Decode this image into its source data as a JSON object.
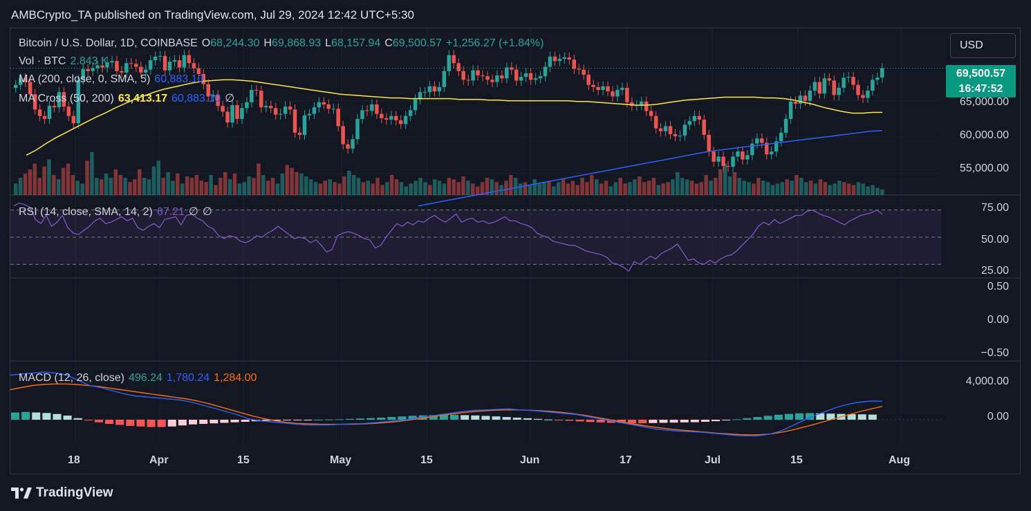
{
  "header": {
    "published": "AMBCrypto_TA published on TradingView.com, Jul 29, 2024 12:42 UTC+5:30"
  },
  "legend": {
    "symbol": "Bitcoin / U.S. Dollar, 1D, COINBASE",
    "open_label": "O",
    "open": "68,244.30",
    "high_label": "H",
    "high": "69,868.93",
    "low_label": "L",
    "low": "68,157.94",
    "close_label": "C",
    "close": "69,500.57",
    "change": "+1,256.27 (+1.84%)",
    "vol_label": "Vol · BTC",
    "vol": "2.843 K",
    "ma_label": "MA (200, close, 0, SMA, 5)",
    "ma_value": "60,883.10",
    "macross_label": "MA Cross (50, 200)",
    "macross_fast": "63,413.17",
    "macross_slow": "60,883.10",
    "macross_extra": "∅",
    "rsi_label": "RSI (14, close, SMA, 14, 2)",
    "rsi_value": "67.21",
    "rsi_extra1": "∅",
    "rsi_extra2": "∅",
    "macd_label": "MACD (12, 26, close)",
    "macd_hist": "496.24",
    "macd_line": "1,780.24",
    "macd_signal": "1,284.00"
  },
  "currency_button": "USD",
  "price_tag": {
    "price": "69,500.57",
    "countdown": "16:47:52"
  },
  "footer": {
    "brand": "TradingView"
  },
  "colors": {
    "up": "#26a69a",
    "down": "#ef5350",
    "ma200": "#2962ff",
    "ma50": "#ffeb3b",
    "rsi": "#7e57c2",
    "macd_fast": "#2962ff",
    "macd_slow": "#ff6d00"
  },
  "chart_data": {
    "type": "candlestick",
    "price_axis": {
      "ticks": [
        "65,000.00",
        "60,000.00",
        "55,000.00"
      ],
      "tick_values": [
        65000,
        60000,
        55000
      ],
      "ylim": [
        52000,
        75000
      ]
    },
    "x_axis": {
      "ticks": [
        "18",
        "Apr",
        "15",
        "May",
        "15",
        "Jun",
        "17",
        "Jul",
        "15",
        "Aug"
      ]
    },
    "rsi_axis": {
      "ticks": [
        "75.00",
        "50.00",
        "25.00"
      ],
      "ylim": [
        20,
        80
      ],
      "bands": [
        70,
        50,
        30
      ]
    },
    "empty_pane_axis": {
      "ticks": [
        "0.50",
        "0.00",
        "−0.50"
      ]
    },
    "macd_axis": {
      "ticks": [
        "4,000.00",
        "0.00"
      ],
      "ylim": [
        -2200,
        5600
      ]
    },
    "close": [
      67200,
      68100,
      67600,
      65900,
      63800,
      62900,
      62500,
      64300,
      64100,
      66200,
      64200,
      62900,
      61900,
      67900,
      69400,
      69100,
      69500,
      69900,
      69600,
      70300,
      70500,
      69100,
      68900,
      70200,
      70100,
      69700,
      68900,
      69300,
      70600,
      71100,
      71200,
      69200,
      70400,
      70600,
      69600,
      71300,
      70200,
      69500,
      68700,
      67300,
      65600,
      65800,
      64300,
      63500,
      62000,
      64400,
      62500,
      64000,
      64800,
      66500,
      66400,
      64100,
      64300,
      64000,
      63100,
      63200,
      64200,
      63800,
      60600,
      60300,
      63000,
      63200,
      64100,
      64800,
      64500,
      63900,
      63900,
      61500,
      59000,
      58400,
      59700,
      62500,
      63700,
      63600,
      64500,
      63200,
      62600,
      62400,
      62900,
      62300,
      61800,
      62900,
      63700,
      65200,
      66200,
      66200,
      67000,
      66300,
      66900,
      69100,
      71300,
      70200,
      69100,
      67900,
      67800,
      69200,
      68500,
      68400,
      67900,
      67600,
      68500,
      68100,
      69600,
      69300,
      67800,
      68300,
      68800,
      67900,
      68100,
      68400,
      69700,
      71100,
      70500,
      70800,
      71000,
      70700,
      69400,
      69300,
      68600,
      67200,
      66900,
      66500,
      67000,
      66300,
      65600,
      66500,
      66800,
      64800,
      64300,
      64400,
      64900,
      63600,
      62900,
      61200,
      60800,
      61500,
      60400,
      60100,
      60200,
      61700,
      62200,
      62900,
      62400,
      60300,
      58000,
      56600,
      57300,
      56000,
      55900,
      57300,
      58000,
      56900,
      57500,
      59100,
      59800,
      59200,
      57600,
      58000,
      59400,
      60600,
      62500,
      64900,
      64600,
      65700,
      65000,
      66400,
      67600,
      66000,
      68100,
      67800,
      65800,
      66800,
      68200,
      68300,
      67200,
      65800,
      65400,
      66400,
      67900,
      68200,
      69500
    ],
    "ma50": [
      57500,
      58200,
      59100,
      59900,
      60600,
      61300,
      62000,
      62700,
      63300,
      64000,
      64600,
      65200,
      65700,
      66200,
      66600,
      66900,
      67200,
      67500,
      67700,
      67800,
      67900,
      67900,
      67800,
      67700,
      67500,
      67300,
      67100,
      66900,
      66700,
      66500,
      66300,
      66100,
      65900,
      65800,
      65700,
      65600,
      65500,
      65400,
      65400,
      65300,
      65300,
      65300,
      65300,
      65300,
      65200,
      65200,
      65200,
      65100,
      65100,
      65000,
      65000,
      65000,
      65000,
      65000,
      65000,
      65000,
      64900,
      64900,
      64800,
      64700,
      64600,
      64500,
      64400,
      64400,
      64500,
      64700,
      64900,
      65100,
      65200,
      65300,
      65400,
      65500,
      65500,
      65500,
      65500,
      65400,
      65400,
      65300,
      65100,
      64800,
      64500,
      64100,
      63800,
      63500,
      63300,
      63300,
      63400,
      63400
    ],
    "ma200": [
      50500,
      50800,
      51100,
      51400,
      51700,
      52000,
      52300,
      52600,
      52900,
      53200,
      53500,
      53800,
      54100,
      54400,
      54700,
      55000,
      55300,
      55600,
      55900,
      56200,
      56500,
      56800,
      57100,
      57400,
      57700,
      58000,
      58200,
      58400,
      58600,
      58800,
      59000,
      59200,
      59400,
      59600,
      59800,
      60000,
      60200,
      60400,
      60600,
      60800,
      60883
    ],
    "volume": [
      8,
      12,
      15,
      18,
      22,
      12,
      20,
      25,
      14,
      11,
      19,
      22,
      14,
      10,
      8,
      24,
      30,
      12,
      11,
      15,
      12,
      18,
      14,
      12,
      9,
      11,
      18,
      12,
      11,
      20,
      24,
      12,
      16,
      10,
      15,
      8,
      13,
      12,
      14,
      10,
      9,
      14,
      7,
      12,
      16,
      11,
      15,
      8,
      9,
      13,
      12,
      22,
      14,
      10,
      12,
      8,
      15,
      21,
      19,
      16,
      15,
      13,
      11,
      9,
      8,
      10,
      11,
      9,
      8,
      13,
      17,
      14,
      12,
      9,
      10,
      8,
      12,
      7,
      9,
      14,
      11,
      9,
      6,
      8,
      10,
      12,
      9,
      7,
      11,
      10,
      8,
      12,
      11,
      9,
      13,
      10,
      8,
      6,
      9,
      12,
      11,
      9,
      7,
      10,
      14,
      12,
      8,
      9,
      7,
      11,
      8,
      9,
      10,
      6,
      9,
      11,
      8,
      10,
      7,
      12,
      9,
      14,
      11,
      8,
      10,
      6,
      9,
      12,
      8,
      9,
      11,
      13,
      9,
      10,
      12,
      7,
      8,
      9,
      11,
      16,
      12,
      11,
      10,
      8,
      9,
      14,
      10,
      12,
      18,
      22,
      13,
      16,
      12,
      10,
      9,
      8,
      12,
      10,
      9,
      7,
      8,
      9,
      11,
      10,
      14,
      12,
      9,
      10,
      8,
      11,
      9,
      7,
      8,
      10,
      9,
      8,
      7,
      9,
      8,
      6,
      7,
      5,
      4
    ],
    "rsi": [
      73,
      75,
      74,
      72,
      63,
      60,
      66,
      58,
      61,
      66,
      57,
      53,
      52,
      55,
      58,
      62,
      64,
      60,
      61,
      63,
      65,
      62,
      64,
      57,
      55,
      58,
      60,
      57,
      63,
      64,
      65,
      59,
      66,
      67,
      64,
      62,
      58,
      56,
      51,
      49,
      51,
      50,
      47,
      46,
      48,
      51,
      50,
      53,
      55,
      58,
      55,
      52,
      49,
      50,
      49,
      46,
      48,
      44,
      39,
      41,
      51,
      53,
      54,
      53,
      51,
      49,
      48,
      42,
      44,
      50,
      55,
      60,
      58,
      61,
      59,
      62,
      61,
      64,
      66,
      63,
      61,
      64,
      67,
      61,
      63,
      64,
      61,
      62,
      60,
      61,
      63,
      65,
      62,
      62,
      60,
      59,
      57,
      53,
      51,
      50,
      47,
      46,
      45,
      44,
      44,
      42,
      40,
      39,
      38,
      37,
      35,
      31,
      30,
      28,
      25,
      32,
      30,
      33,
      36,
      34,
      38,
      40,
      42,
      45,
      39,
      33,
      34,
      31,
      30,
      33,
      31,
      34,
      36,
      37,
      40,
      44,
      48,
      52,
      58,
      61,
      59,
      63,
      60,
      62,
      64,
      66,
      66,
      69,
      70,
      68,
      66,
      65,
      63,
      61,
      59,
      62,
      64,
      66,
      67,
      68,
      70,
      67
    ],
    "macd_line": [
      4300,
      4400,
      4500,
      4600,
      4500,
      4300,
      3800,
      3300,
      3100,
      2800,
      2500,
      2300,
      2200,
      2100,
      2000,
      1900,
      1700,
      1400,
      1100,
      800,
      500,
      100,
      -100,
      -200,
      -300,
      -400,
      -500,
      -500,
      -500,
      -450,
      -400,
      -380,
      -300,
      -200,
      -100,
      0,
      200,
      350,
      500,
      650,
      800,
      900,
      950,
      1000,
      1050,
      950,
      900,
      800,
      700,
      600,
      500,
      300,
      100,
      -100,
      -300,
      -500,
      -700,
      -900,
      -1000,
      -1100,
      -1150,
      -1200,
      -1300,
      -1400,
      -1500,
      -1550,
      -1550,
      -1400,
      -1100,
      -600,
      -100,
      400,
      800,
      1200,
      1500,
      1700,
      1800,
      1780
    ],
    "macd_signal": [
      2900,
      3100,
      3300,
      3400,
      3450,
      3450,
      3400,
      3300,
      3200,
      3050,
      2900,
      2750,
      2600,
      2450,
      2300,
      2150,
      2000,
      1800,
      1550,
      1250,
      950,
      650,
      350,
      100,
      -100,
      -250,
      -350,
      -400,
      -430,
      -440,
      -440,
      -430,
      -400,
      -350,
      -280,
      -180,
      -50,
      100,
      250,
      400,
      550,
      680,
      780,
      860,
      920,
      950,
      950,
      920,
      870,
      800,
      700,
      580,
      430,
      250,
      60,
      -130,
      -320,
      -500,
      -660,
      -800,
      -920,
      -1020,
      -1110,
      -1200,
      -1290,
      -1370,
      -1430,
      -1460,
      -1440,
      -1350,
      -1180,
      -950,
      -680,
      -390,
      -100,
      200,
      500,
      800,
      1050,
      1284
    ],
    "macd_hist": [
      700,
      750,
      700,
      650,
      550,
      400,
      150,
      -50,
      -250,
      -400,
      -500,
      -600,
      -650,
      -700,
      -700,
      -650,
      -550,
      -450,
      -400,
      -350,
      -300,
      -250,
      -200,
      -150,
      -100,
      -80,
      -60,
      -40,
      -20,
      0,
      20,
      40,
      80,
      120,
      160,
      200,
      260,
      320,
      380,
      420,
      450,
      470,
      470,
      440,
      410,
      370,
      320,
      260,
      200,
      140,
      80,
      20,
      -40,
      -100,
      -160,
      -220,
      -260,
      -300,
      -320,
      -340,
      -340,
      -320,
      -300,
      -280,
      -260,
      -240,
      -200,
      -140,
      -60,
      40,
      150,
      260,
      380,
      480,
      560,
      620,
      640,
      620,
      590,
      560,
      540,
      520,
      496
    ],
    "macd_hist_x": [
      0.0,
      0.012,
      0.024,
      0.036,
      0.048,
      0.06,
      0.072,
      0.084,
      0.096,
      0.108,
      0.12,
      0.132,
      0.144,
      0.156,
      0.168,
      0.18,
      0.192,
      0.204,
      0.216,
      0.228,
      0.24,
      0.252,
      0.264,
      0.276,
      0.288,
      0.3,
      0.312,
      0.324,
      0.336,
      0.348,
      0.36,
      0.372,
      0.384,
      0.396,
      0.408,
      0.42,
      0.432,
      0.444,
      0.456,
      0.468,
      0.48,
      0.492,
      0.504,
      0.516,
      0.528,
      0.54,
      0.552,
      0.564,
      0.576,
      0.588,
      0.6,
      0.612,
      0.624,
      0.636,
      0.648,
      0.66,
      0.672,
      0.684,
      0.696,
      0.708,
      0.72,
      0.732,
      0.744,
      0.756,
      0.768,
      0.78,
      0.792,
      0.804,
      0.816,
      0.828,
      0.84,
      0.852,
      0.864,
      0.876,
      0.888,
      0.9,
      0.912,
      0.924,
      0.936,
      0.948,
      0.96,
      0.972,
      0.984
    ]
  }
}
